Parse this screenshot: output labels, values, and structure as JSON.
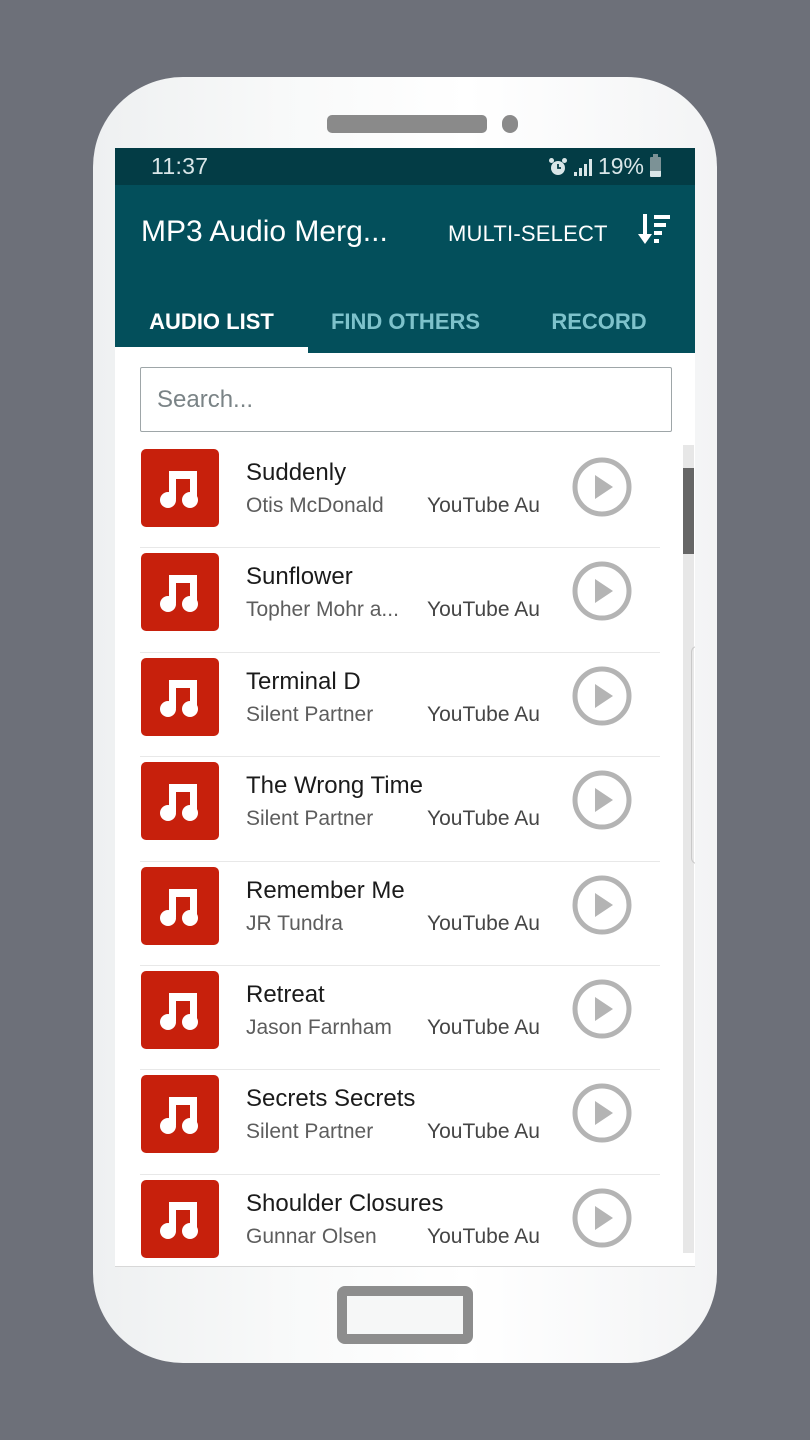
{
  "status_bar": {
    "time": "11:37",
    "battery": "19%",
    "icons": [
      "alarm-icon",
      "signal-icon",
      "battery-icon"
    ]
  },
  "app_bar": {
    "title": "MP3 Audio Merg...",
    "multi_select_label": "MULTI-SELECT",
    "sort_icon": "sort-descending-icon"
  },
  "tabs": [
    {
      "label": "AUDIO LIST",
      "active": true
    },
    {
      "label": "FIND OTHERS",
      "active": false
    },
    {
      "label": "RECORD",
      "active": false
    }
  ],
  "search": {
    "placeholder": "Search...",
    "value": ""
  },
  "songs": [
    {
      "title": "Suddenly",
      "artist": "Otis McDonald",
      "source": "YouTube Au"
    },
    {
      "title": "Sunflower",
      "artist": "Topher Mohr a...",
      "source": "YouTube Au"
    },
    {
      "title": "Terminal D",
      "artist": "Silent Partner",
      "source": "YouTube Au"
    },
    {
      "title": "The Wrong Time",
      "artist": "Silent Partner",
      "source": "YouTube Au"
    },
    {
      "title": "Remember Me",
      "artist": "JR Tundra",
      "source": "YouTube Au"
    },
    {
      "title": "Retreat",
      "artist": "Jason Farnham",
      "source": "YouTube Au"
    },
    {
      "title": "Secrets Secrets",
      "artist": "Silent Partner",
      "source": "YouTube Au"
    },
    {
      "title": "Shoulder Closures",
      "artist": "Gunnar Olsen",
      "source": "YouTube Au"
    }
  ],
  "colors": {
    "status_bar": "#033c45",
    "app_bar": "#034f5b",
    "inactive_tab": "#7ec2cb",
    "thumbnail": "#c7200c",
    "play_icon": "#b4b4b4",
    "background": "#6d7079"
  }
}
